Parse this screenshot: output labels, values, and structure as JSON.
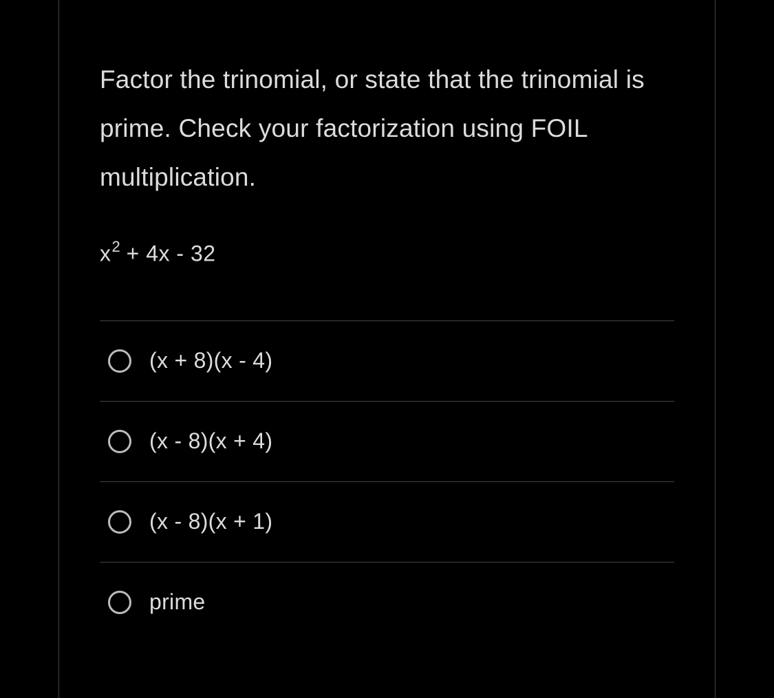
{
  "question": {
    "prompt": "Factor the trinomial, or state that the trinomial is prime. Check your factorization using FOIL multiplication.",
    "expression_base": "x",
    "expression_exp": "2",
    "expression_rest": " + 4x - 32"
  },
  "options": [
    {
      "label": "(x + 8)(x - 4)"
    },
    {
      "label": "(x - 8)(x + 4)"
    },
    {
      "label": "(x - 8)(x + 1)"
    },
    {
      "label": "prime"
    }
  ]
}
